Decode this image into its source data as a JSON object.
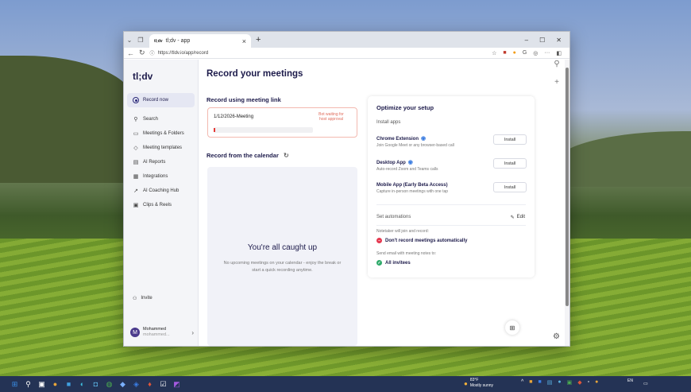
{
  "browser": {
    "tab_favicon": "tl;dv",
    "tab_title": "tl;dv - app",
    "url": "https://tldv.io/app/record"
  },
  "sidebar": {
    "logo": "tl;dv",
    "items": [
      {
        "label": "Record now",
        "icon": "record-icon"
      },
      {
        "label": "Search",
        "icon": "search-icon"
      },
      {
        "label": "Meetings & Folders",
        "icon": "video-icon"
      },
      {
        "label": "Meeting templates",
        "icon": "tag-icon"
      },
      {
        "label": "AI Reports",
        "icon": "report-icon"
      },
      {
        "label": "Integrations",
        "icon": "grid-icon"
      },
      {
        "label": "AI Coaching Hub",
        "icon": "trend-icon"
      },
      {
        "label": "Clips & Reels",
        "icon": "clip-icon"
      }
    ],
    "invite": "Invite",
    "user": {
      "initial": "M",
      "name": "Mohammed",
      "email": "mohammed..."
    }
  },
  "main": {
    "title": "Record your meetings",
    "link_heading": "Record using meeting link",
    "meeting": {
      "title": "1/12/2026-Meeting",
      "status": "Bot waiting for host approval"
    },
    "calendar_heading": "Record from the calendar",
    "calendar_empty_title": "You're all caught up",
    "calendar_empty_desc": "No upcoming meetings on your calendar - enjoy the break or start a quick recording anytime."
  },
  "setup": {
    "title": "Optimize your setup",
    "install_apps": "Install apps",
    "apps": [
      {
        "name": "Chrome Extension",
        "desc": "Join Google Meet or any browser-based call",
        "button": "Install"
      },
      {
        "name": "Desktop App",
        "desc": "Auto-record Zoom and Teams calls",
        "button": "Install"
      },
      {
        "name": "Mobile App (Early Beta Access)",
        "desc": "Capture in-person meetings with one tap",
        "button": "Install"
      }
    ],
    "automations_title": "Set automations",
    "edit": "Edit",
    "notetaker_label": "Notetaker will join and record:",
    "record_status": "Don't record meetings automatically",
    "email_label": "Send email with meeting notes to:",
    "email_status": "All invitees"
  },
  "taskbar": {
    "weather_temp": "83°F",
    "weather_desc": "Mostly sunny",
    "lang": "EN"
  }
}
